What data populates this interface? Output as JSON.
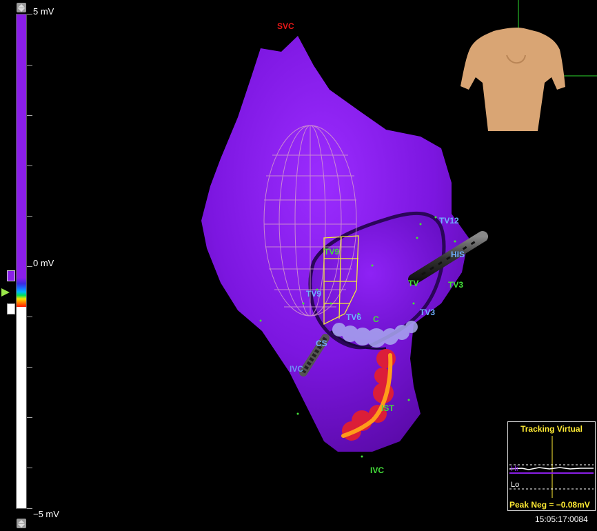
{
  "scale": {
    "top_label": "5 mV",
    "mid_label": "0 mV",
    "bottom_label": "−5 mV"
  },
  "anatomy_labels": {
    "svc": "SVC",
    "ivc": "IVC",
    "his": "HIS",
    "tv": "TV",
    "tv3_right": "TV3",
    "tv3_lower": "TV3",
    "tv6": "TV6",
    "tv9_green": "TV9",
    "tv9_blue": "TV9",
    "tv12": "TV12",
    "c": "C",
    "cs": "CS",
    "ivc_small": "IVC",
    "ist": "IST"
  },
  "tracking": {
    "title": "Tracking Virtual",
    "hi_label": "Hi",
    "lo_label": "Lo",
    "peak_label": "Peak Neg = −0.08mV"
  },
  "timestamp": "15:05:17:0084",
  "colors": {
    "chamber": "#8a1ee8",
    "green_label": "#44e03a",
    "blue_label": "#6fb0ff",
    "red_label": "#e81818",
    "ablation": "#ff1a1a",
    "tracking_text": "#ffeb33"
  }
}
